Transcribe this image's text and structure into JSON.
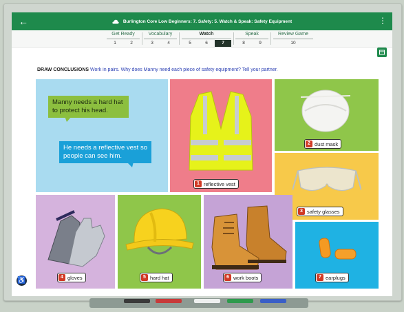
{
  "app": {
    "title": "Burlington Core Low Beginners: 7. Safety: 5. Watch & Speak: Safety Equipment",
    "back_icon": "back-arrow-icon",
    "menu_icon": "more-vert-icon",
    "brand_color": "#1e8a4c"
  },
  "tabs": [
    {
      "name": "Get Ready",
      "pages": [
        "1",
        "2"
      ]
    },
    {
      "name": "Vocabulary",
      "pages": [
        "3",
        "4"
      ]
    },
    {
      "name": "Watch",
      "pages": [
        "5",
        "6",
        "7"
      ]
    },
    {
      "name": "Speak",
      "pages": [
        "8",
        "9"
      ]
    },
    {
      "name": "Review Game",
      "pages": [
        "10"
      ]
    }
  ],
  "current_page": "7",
  "instruction": {
    "lead": "DRAW CONCLUSIONS",
    "text": " Work in pairs. Why does Manny need each piece of safety equipment? Tell your partner."
  },
  "bubbles": {
    "first": "Manny needs a hard hat to protect his head.",
    "second": "He needs a reflective vest so people can see him."
  },
  "items": [
    {
      "number": "1",
      "label": "reflective vest"
    },
    {
      "number": "2",
      "label": "dust mask"
    },
    {
      "number": "3",
      "label": "safety glasses"
    },
    {
      "number": "4",
      "label": "gloves"
    },
    {
      "number": "5",
      "label": "hard hat"
    },
    {
      "number": "6",
      "label": "work boots"
    },
    {
      "number": "7",
      "label": "earplugs"
    }
  ]
}
